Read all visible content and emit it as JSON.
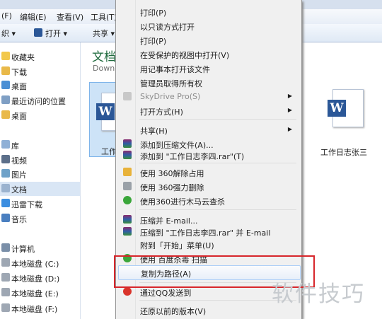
{
  "menubar": {
    "file": "(F)",
    "edit": "编辑(E)",
    "view": "查看(V)",
    "tools": "工具(T)"
  },
  "toolbar": {
    "organize": "织 ▾",
    "open": "打开 ▾",
    "share": "共享 ▾"
  },
  "sidebar": {
    "favorites": "收藏夹",
    "downloads": "下载",
    "desktop": "桌面",
    "recent": "最近访问的位置",
    "desktop2": "桌面",
    "libraries": "库",
    "video": "视频",
    "pictures": "图片",
    "documents": "文档",
    "xunlei": "迅雷下载",
    "music": "音乐",
    "computer": "计算机",
    "drive_c": "本地磁盘 (C:)",
    "drive_d": "本地磁盘 (D:)",
    "drive_e": "本地磁盘 (E:)",
    "drive_f": "本地磁盘 (F:)"
  },
  "main": {
    "title": "文档",
    "subtitle": "Downl",
    "file1": "工作",
    "file2": "工作日志张三"
  },
  "context_menu": {
    "items": [
      "打印(P)",
      "以只读方式打开",
      "打印(P)",
      "在受保护的视图中打开(V)",
      "用记事本打开该文件",
      "管理员取得所有权",
      "SkyDrive Pro(S)",
      "打开方式(H)",
      "共享(H)",
      "添加到压缩文件(A)...",
      "添加到 \"工作日志李四.rar\"(T)",
      "使用 360解除占用",
      "使用 360强力删除",
      "使用360进行木马云查杀",
      "压缩并 E-mail...",
      "压缩到 \"工作日志李四.rar\" 并 E-mail",
      "附到「开始」菜单(U)",
      "使用 百度杀毒 扫描",
      "复制为路径(A)",
      "通过QQ发送到",
      "还原以前的版本(V)"
    ]
  },
  "watermark": "软件技巧",
  "colors": {
    "accent": "#2b5797",
    "highlight_box": "#d7262b"
  }
}
